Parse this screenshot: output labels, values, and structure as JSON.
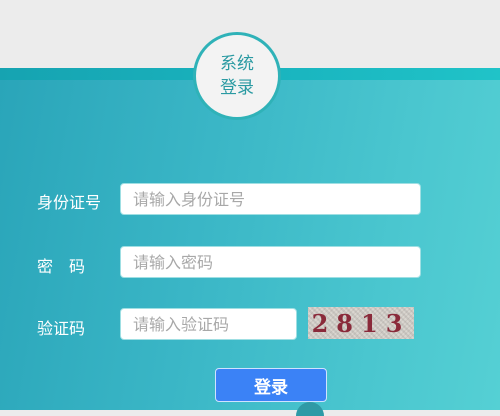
{
  "header": {
    "badge_line1": "系统",
    "badge_line2": "登录"
  },
  "form": {
    "id_label": "身份证号",
    "id_placeholder": "请输入身份证号",
    "password_label": "密　码",
    "password_placeholder": "请输入密码",
    "captcha_label": "验证码",
    "captcha_placeholder": "请输入验证码",
    "captcha_text": "2813",
    "login_label": "登录"
  },
  "colors": {
    "accent": "#2fb2b8",
    "button": "#3b82f6"
  }
}
